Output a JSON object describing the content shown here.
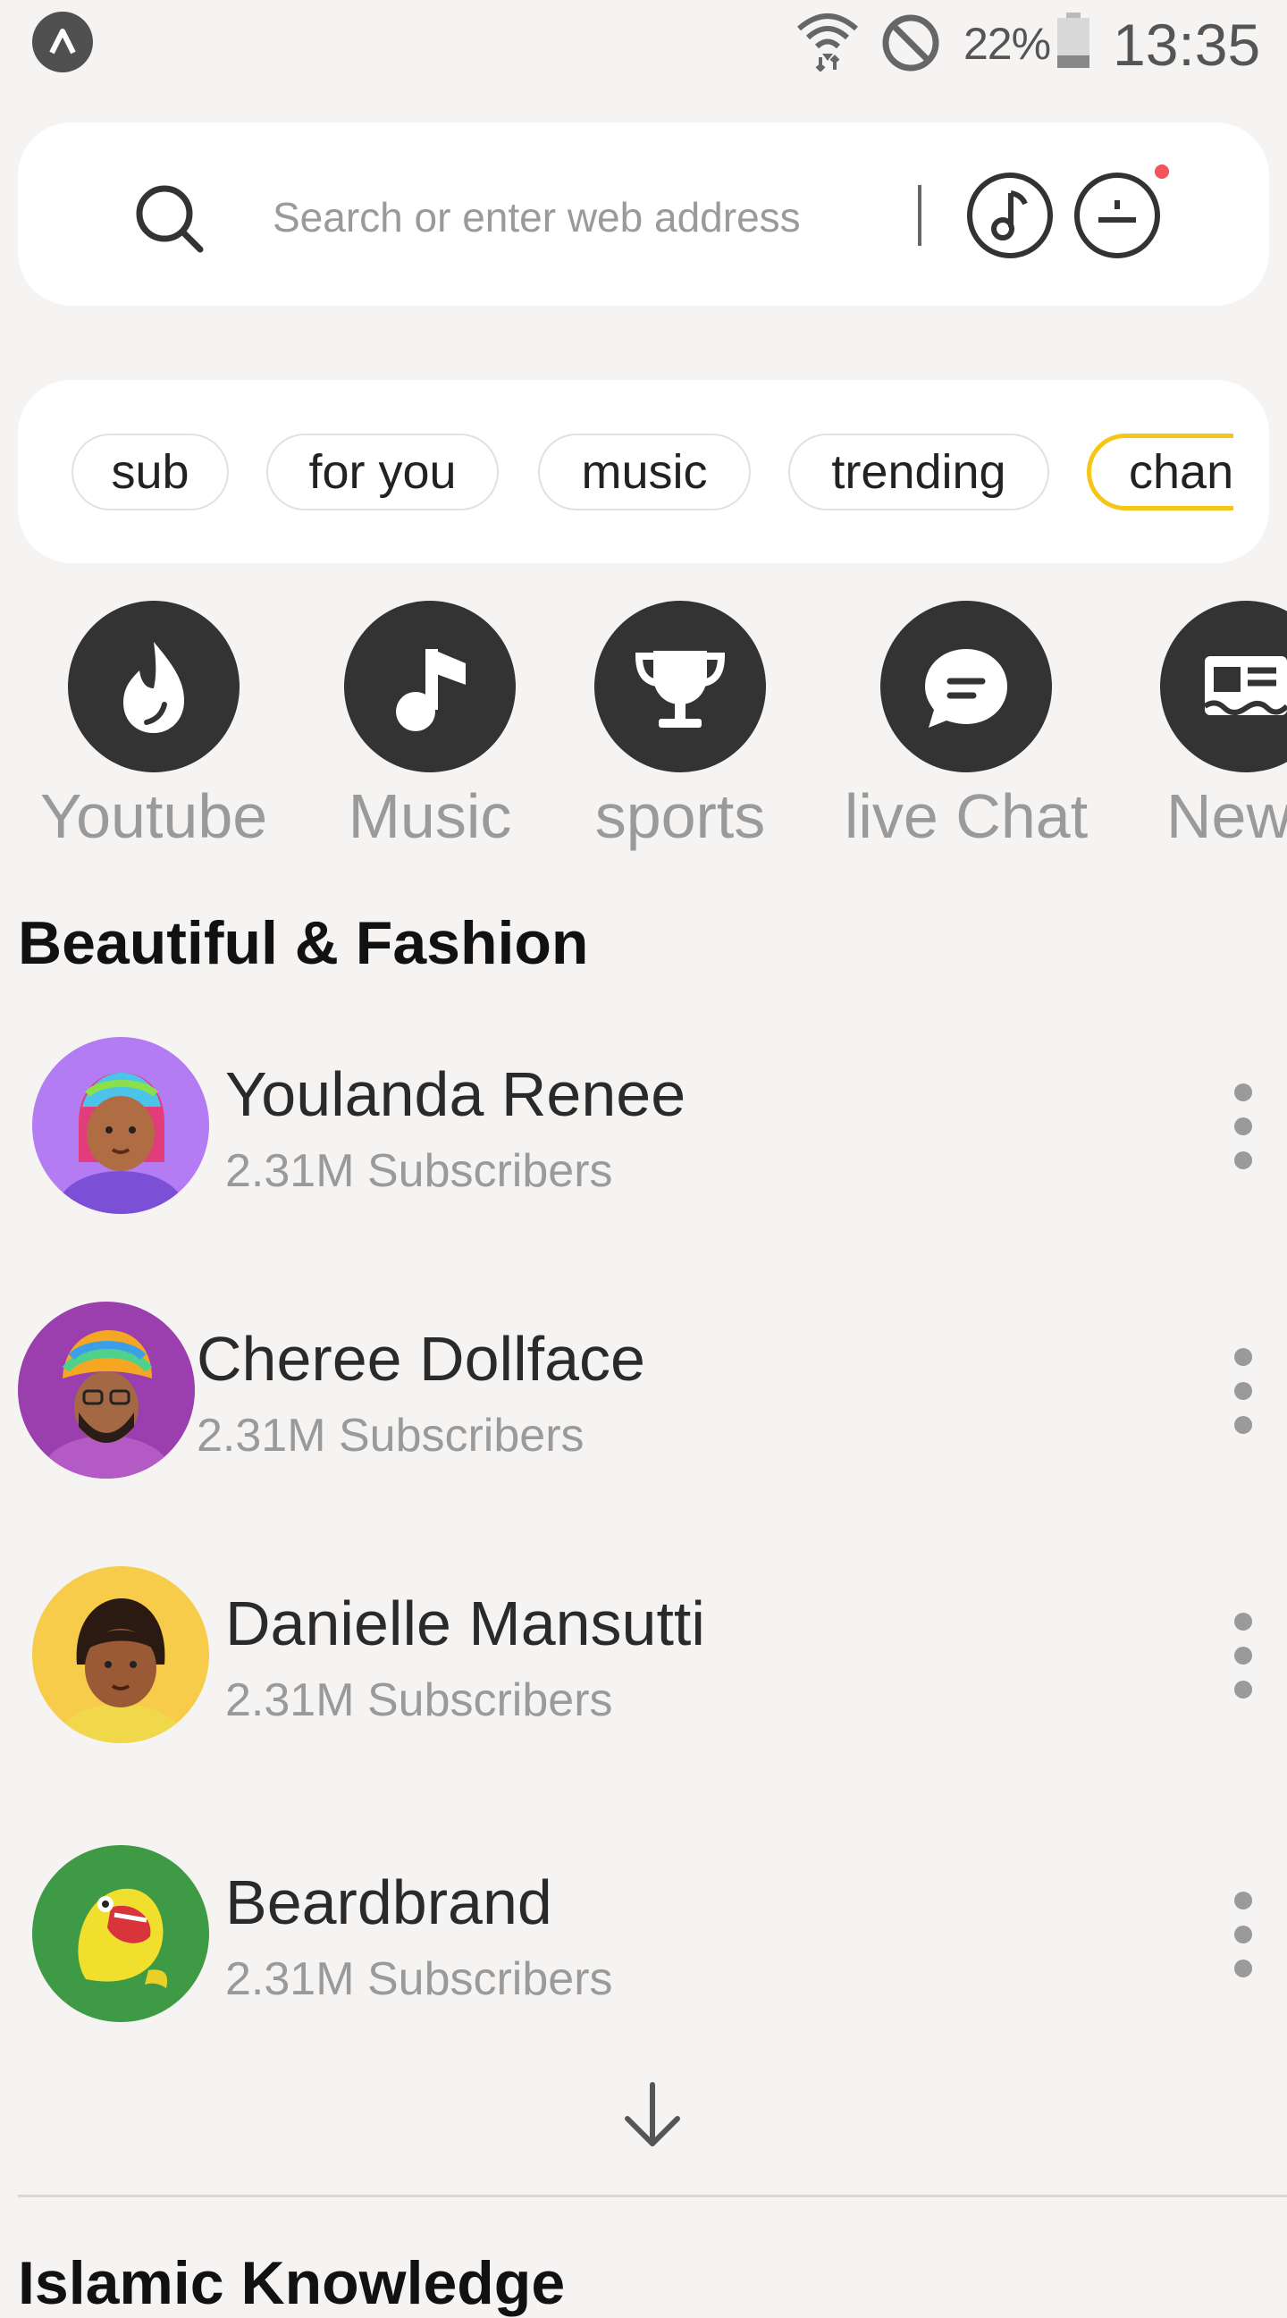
{
  "status_bar": {
    "battery": "22%",
    "time": "13:35",
    "icons": [
      "app-badge-icon",
      "wifi-icon",
      "do-not-disturb-icon",
      "battery-icon"
    ]
  },
  "search": {
    "placeholder": "Search or enter web address"
  },
  "chips": [
    "sub",
    "for you",
    "music",
    "trending",
    "chan"
  ],
  "active_chip": "chan",
  "accent_color": "#f5c518",
  "categories": [
    {
      "label": "Youtube",
      "icon": "flame-icon"
    },
    {
      "label": "Music",
      "icon": "music-note-icon"
    },
    {
      "label": "sports",
      "icon": "trophy-icon"
    },
    {
      "label": "live Chat",
      "icon": "chat-bubble-icon"
    },
    {
      "label": "New",
      "icon": "newspaper-icon"
    }
  ],
  "section": {
    "title": "Beautiful & Fashion",
    "channels": [
      {
        "name": "Youlanda Renee",
        "subscribers": "2.31M Subscribers",
        "avatar_color": "#b37cf2"
      },
      {
        "name": "Cheree Dollface",
        "subscribers": "2.31M Subscribers",
        "avatar_color": "#9b3fae"
      },
      {
        "name": "Danielle Mansutti",
        "subscribers": "2.31M Subscribers",
        "avatar_color": "#f6cc4a"
      },
      {
        "name": "Beardbrand",
        "subscribers": "2.31M Subscribers",
        "avatar_color": "#3f9a45"
      }
    ]
  },
  "next_section": {
    "title": "Islamic Knowledge"
  }
}
